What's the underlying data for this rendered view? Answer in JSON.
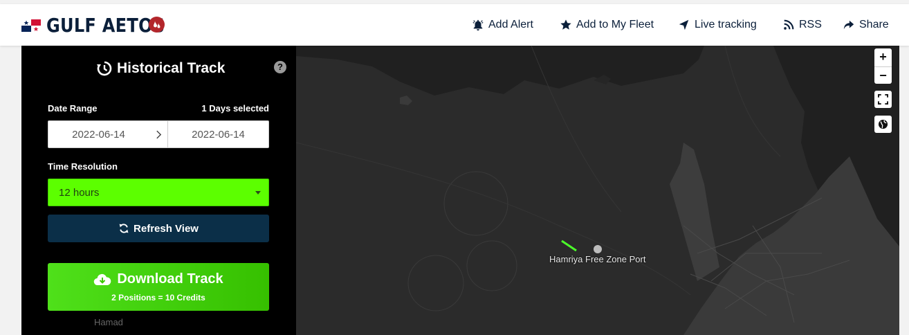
{
  "header": {
    "vessel_name": "GULF AETOS",
    "nav": [
      {
        "label": "Add Alert",
        "icon": "bell-icon"
      },
      {
        "label": "Add to My Fleet",
        "icon": "star-icon"
      },
      {
        "label": "Live tracking",
        "icon": "navigation-arrow-icon"
      },
      {
        "label": "RSS",
        "icon": "rss-icon"
      },
      {
        "label": "Share",
        "icon": "share-icon"
      }
    ]
  },
  "panel": {
    "title": "Historical Track",
    "date_range_label": "Date Range",
    "days_selected": "1 Days selected",
    "date_from": "2022-06-14",
    "date_to": "2022-06-14",
    "time_resolution_label": "Time Resolution",
    "time_resolution_value": "12 hours",
    "refresh_label": "Refresh View",
    "download_label": "Download Track",
    "download_sub": "2 Positions = 10 Credits",
    "map_place_label": "Hamad"
  },
  "map": {
    "port_label": "Hamriya Free Zone Port",
    "zoom_in": "+",
    "zoom_out": "−"
  },
  "colors": {
    "brand_navy": "#0b1f3a",
    "accent_green": "#5cff00",
    "refresh_blue": "#0b2f48",
    "track_green": "#4cff2a"
  }
}
